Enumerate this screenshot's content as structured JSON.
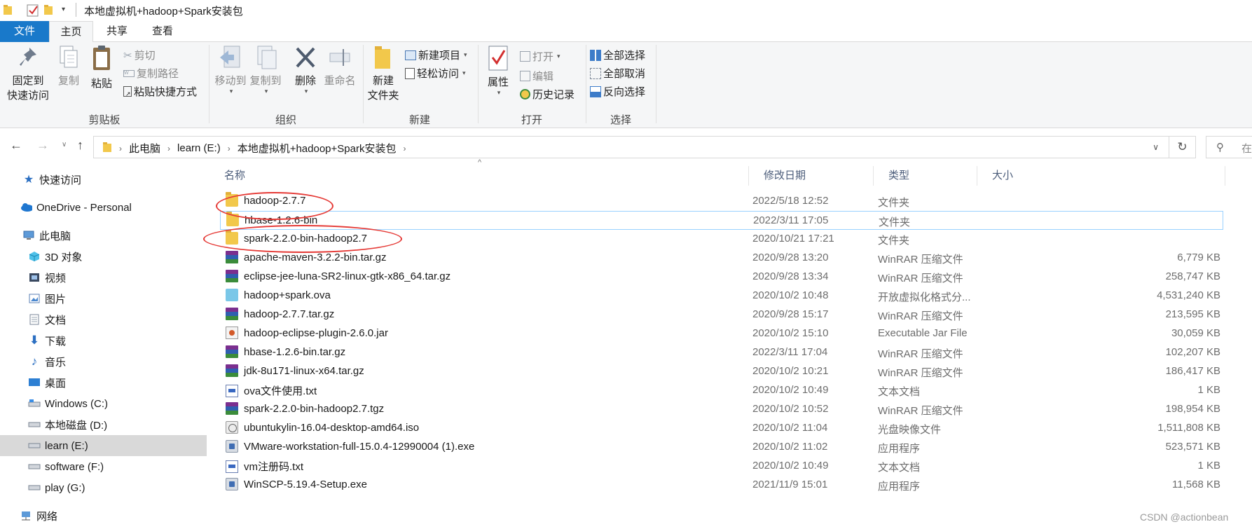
{
  "window": {
    "title": "本地虚拟机+hadoop+Spark安装包"
  },
  "tabs": [
    {
      "label": "文件"
    },
    {
      "label": "主页"
    },
    {
      "label": "共享"
    },
    {
      "label": "查看"
    }
  ],
  "ribbon": {
    "clipboard": {
      "label": "剪贴板",
      "pin_line1": "固定到",
      "pin_line2": "快速访问",
      "copy": "复制",
      "paste": "粘贴",
      "cut": "剪切",
      "copy_path": "复制路径",
      "paste_shortcut": "粘贴快捷方式"
    },
    "organize": {
      "label": "组织",
      "move_to": "移动到",
      "copy_to": "复制到",
      "delete": "删除",
      "rename": "重命名"
    },
    "new": {
      "label": "新建",
      "new_folder_line1": "新建",
      "new_folder_line2": "文件夹",
      "new_item": "新建项目",
      "easy_access": "轻松访问"
    },
    "open": {
      "label": "打开",
      "properties": "属性",
      "open": "打开",
      "edit": "编辑",
      "history": "历史记录"
    },
    "select": {
      "label": "选择",
      "select_all": "全部选择",
      "select_none": "全部取消",
      "invert": "反向选择"
    }
  },
  "address": {
    "crumbs": [
      "此电脑",
      "learn (E:)",
      "本地虚拟机+hadoop+Spark安装包"
    ],
    "search_placeholder": "在"
  },
  "nav_pane": [
    {
      "label": "快速访问",
      "icon": "star-icon"
    },
    {
      "label": "OneDrive - Personal",
      "icon": "cloud-icon"
    },
    {
      "label": "此电脑",
      "icon": "computer-icon"
    },
    {
      "label": "3D 对象",
      "icon": "cube-icon"
    },
    {
      "label": "视频",
      "icon": "video-icon"
    },
    {
      "label": "图片",
      "icon": "picture-icon"
    },
    {
      "label": "文档",
      "icon": "document-icon"
    },
    {
      "label": "下载",
      "icon": "download-icon"
    },
    {
      "label": "音乐",
      "icon": "music-icon"
    },
    {
      "label": "桌面",
      "icon": "desktop-icon"
    },
    {
      "label": "Windows (C:)",
      "icon": "drive-icon"
    },
    {
      "label": "本地磁盘 (D:)",
      "icon": "drive-icon"
    },
    {
      "label": "learn (E:)",
      "icon": "drive-icon"
    },
    {
      "label": "software (F:)",
      "icon": "drive-icon"
    },
    {
      "label": "play (G:)",
      "icon": "drive-icon"
    },
    {
      "label": "网络",
      "icon": "network-icon"
    }
  ],
  "columns": {
    "name": "名称",
    "date": "修改日期",
    "type": "类型",
    "size": "大小"
  },
  "files": [
    {
      "name": "hadoop-2.7.7",
      "date": "2022/5/18 12:52",
      "type": "文件夹",
      "size": "",
      "icon": "folder-icon"
    },
    {
      "name": "hbase-1.2.6-bin",
      "date": "2022/3/11 17:05",
      "type": "文件夹",
      "size": "",
      "icon": "folder-icon"
    },
    {
      "name": "spark-2.2.0-bin-hadoop2.7",
      "date": "2020/10/21 17:21",
      "type": "文件夹",
      "size": "",
      "icon": "folder-icon"
    },
    {
      "name": "apache-maven-3.2.2-bin.tar.gz",
      "date": "2020/9/28 13:20",
      "type": "WinRAR 压缩文件",
      "size": "6,779 KB",
      "icon": "winrar-icon"
    },
    {
      "name": "eclipse-jee-luna-SR2-linux-gtk-x86_64.tar.gz",
      "date": "2020/9/28 13:34",
      "type": "WinRAR 压缩文件",
      "size": "258,747 KB",
      "icon": "winrar-icon"
    },
    {
      "name": "hadoop+spark.ova",
      "date": "2020/10/2 10:48",
      "type": "开放虚拟化格式分...",
      "size": "4,531,240 KB",
      "icon": "ova-icon"
    },
    {
      "name": "hadoop-2.7.7.tar.gz",
      "date": "2020/9/28 15:17",
      "type": "WinRAR 压缩文件",
      "size": "213,595 KB",
      "icon": "winrar-icon"
    },
    {
      "name": "hadoop-eclipse-plugin-2.6.0.jar",
      "date": "2020/10/2 15:10",
      "type": "Executable Jar File",
      "size": "30,059 KB",
      "icon": "jar-icon"
    },
    {
      "name": "hbase-1.2.6-bin.tar.gz",
      "date": "2022/3/11 17:04",
      "type": "WinRAR 压缩文件",
      "size": "102,207 KB",
      "icon": "winrar-icon"
    },
    {
      "name": "jdk-8u171-linux-x64.tar.gz",
      "date": "2020/10/2 10:21",
      "type": "WinRAR 压缩文件",
      "size": "186,417 KB",
      "icon": "winrar-icon"
    },
    {
      "name": "ova文件使用.txt",
      "date": "2020/10/2 10:49",
      "type": "文本文档",
      "size": "1 KB",
      "icon": "text-file-icon"
    },
    {
      "name": "spark-2.2.0-bin-hadoop2.7.tgz",
      "date": "2020/10/2 10:52",
      "type": "WinRAR 压缩文件",
      "size": "198,954 KB",
      "icon": "winrar-icon"
    },
    {
      "name": "ubuntukylin-16.04-desktop-amd64.iso",
      "date": "2020/10/2 11:04",
      "type": "光盘映像文件",
      "size": "1,511,808 KB",
      "icon": "disc-image-icon"
    },
    {
      "name": "VMware-workstation-full-15.0.4-12990004 (1).exe",
      "date": "2020/10/2 11:02",
      "type": "应用程序",
      "size": "523,571 KB",
      "icon": "application-icon"
    },
    {
      "name": "vm注册码.txt",
      "date": "2020/10/2 10:49",
      "type": "文本文档",
      "size": "1 KB",
      "icon": "text-file-icon"
    },
    {
      "name": "WinSCP-5.19.4-Setup.exe",
      "date": "2021/11/9 15:01",
      "type": "应用程序",
      "size": "11,568 KB",
      "icon": "application-icon"
    }
  ],
  "watermark": "CSDN @actionbean",
  "colors": {
    "accent": "#1979ca",
    "selection": "#d9d9d9",
    "annotation": "#e53935"
  }
}
